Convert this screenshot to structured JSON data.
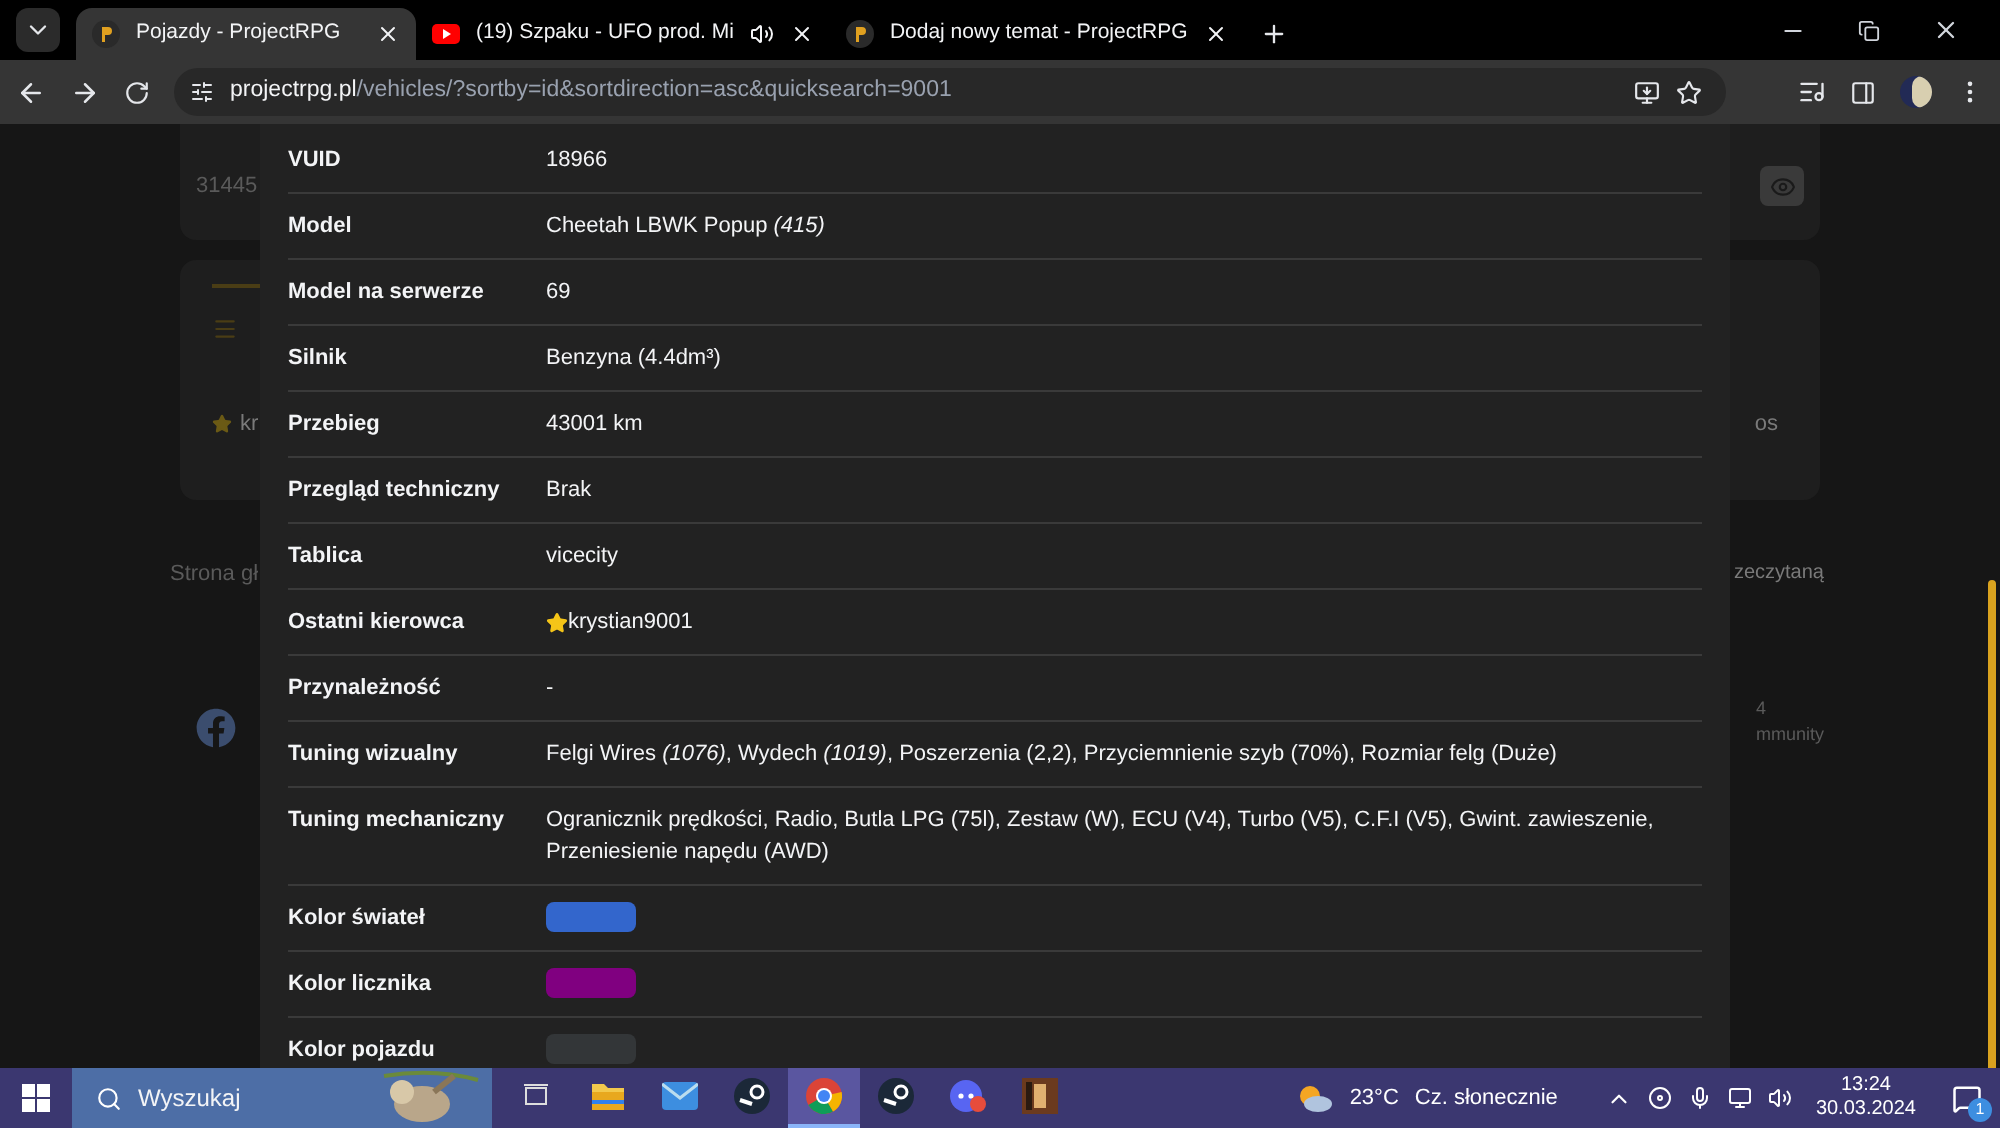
{
  "browser": {
    "tabs": [
      {
        "title": "Pojazdy - ProjectRPG",
        "kind": "site",
        "selected": true,
        "audio": false
      },
      {
        "title": "(19) Szpaku - UFO prod. Mi",
        "kind": "video",
        "selected": false,
        "audio": true
      },
      {
        "title": "Dodaj nowy temat - ProjectRPG",
        "kind": "site",
        "selected": false,
        "audio": false
      }
    ],
    "address": {
      "host": "projectrpg.pl",
      "path": "/vehicles/?sortby=id&sortdirection=asc&quicksearch=9001"
    }
  },
  "background": {
    "card_id": "31445",
    "driver_fragment": "kr",
    "right_fragment": "os",
    "footer_left": "Strona gł",
    "footer_right": "zeczytaną",
    "count_fragment": "4",
    "community_fragment": "mmunity"
  },
  "details": [
    {
      "label": "VUID",
      "kind": "text",
      "value": "18966"
    },
    {
      "label": "Model",
      "kind": "text",
      "value": "Cheetah LBWK Popup *(415)*"
    },
    {
      "label": "Model na serwerze",
      "kind": "text",
      "value": "69"
    },
    {
      "label": "Silnik",
      "kind": "text",
      "value": "Benzyna (4.4dm³)"
    },
    {
      "label": "Przebieg",
      "kind": "text",
      "value": "43001 km"
    },
    {
      "label": "Przegląd techniczny",
      "kind": "text",
      "value": "Brak"
    },
    {
      "label": "Tablica",
      "kind": "text",
      "value": "vicecity"
    },
    {
      "label": "Ostatni kierowca",
      "kind": "player",
      "value": "krystian9001"
    },
    {
      "label": "Przynależność",
      "kind": "text",
      "value": "-"
    },
    {
      "label": "Tuning wizualny",
      "kind": "text",
      "value": "Felgi Wires *(1076)*, Wydech *(1019)*, Poszerzenia (2,2), Przyciemnienie szyb (70%), Rozmiar felg (Duże)"
    },
    {
      "label": "Tuning mechaniczny",
      "kind": "text",
      "value": "Ogranicznik prędkości, Radio, Butla LPG (75l), Zestaw (W), ECU (V4), Turbo (V5), C.F.I (V5), Gwint. zawieszenie, Przeniesienie napędu (AWD)"
    },
    {
      "label": "Kolor świateł",
      "kind": "color",
      "color": "#3366cc"
    },
    {
      "label": "Kolor licznika",
      "kind": "color",
      "color": "#800080"
    },
    {
      "label": "Kolor pojazdu",
      "kind": "color",
      "color": "#333638"
    }
  ],
  "taskbar": {
    "search_placeholder": "Wyszukaj",
    "apps": [
      {
        "kind": "taskview",
        "active": false
      },
      {
        "kind": "folder",
        "active": false
      },
      {
        "kind": "mail",
        "active": false
      },
      {
        "kind": "steam",
        "active": false
      },
      {
        "kind": "chrome",
        "active": true
      },
      {
        "kind": "steam",
        "active": false
      },
      {
        "kind": "discord",
        "active": false
      },
      {
        "kind": "game",
        "active": false
      }
    ],
    "weather": {
      "temp": "23°C",
      "text": "Cz. słonecznie"
    },
    "time": "13:24",
    "date": "30.03.2024",
    "notifications": "1"
  }
}
